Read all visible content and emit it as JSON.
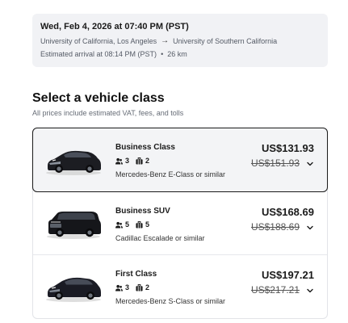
{
  "trip": {
    "datetime": "Wed, Feb 4, 2026 at 07:40 PM (PST)",
    "origin": "University of California, Los Angeles",
    "destination": "University of Southern California",
    "arrival": "Estimated arrival at 08:14 PM (PST)",
    "distance": "26 km"
  },
  "section": {
    "title": "Select a vehicle class",
    "subtitle": "All prices include estimated VAT, fees, and tolls"
  },
  "vehicles": [
    {
      "name": "Business Class",
      "passengers": "3",
      "luggage": "2",
      "model": "Mercedes-Benz E-Class or similar",
      "price": "US$131.93",
      "original_price": "US$151.93",
      "selected": true
    },
    {
      "name": "Business SUV",
      "passengers": "5",
      "luggage": "5",
      "model": "Cadillac Escalade or similar",
      "price": "US$168.69",
      "original_price": "US$188.69",
      "selected": false
    },
    {
      "name": "First Class",
      "passengers": "3",
      "luggage": "2",
      "model": "Mercedes-Benz S-Class or similar",
      "price": "US$197.21",
      "original_price": "US$217.21",
      "selected": false
    }
  ],
  "icons": {
    "route_arrow": "arrow-right-icon",
    "passengers": "person-icon",
    "luggage": "suitcase-icon",
    "expand": "chevron-down-icon"
  },
  "colors": {
    "trip_card_bg": "#f1f2f5",
    "selected_border": "#1a1a1a",
    "selected_bg": "#f3f4f6"
  }
}
